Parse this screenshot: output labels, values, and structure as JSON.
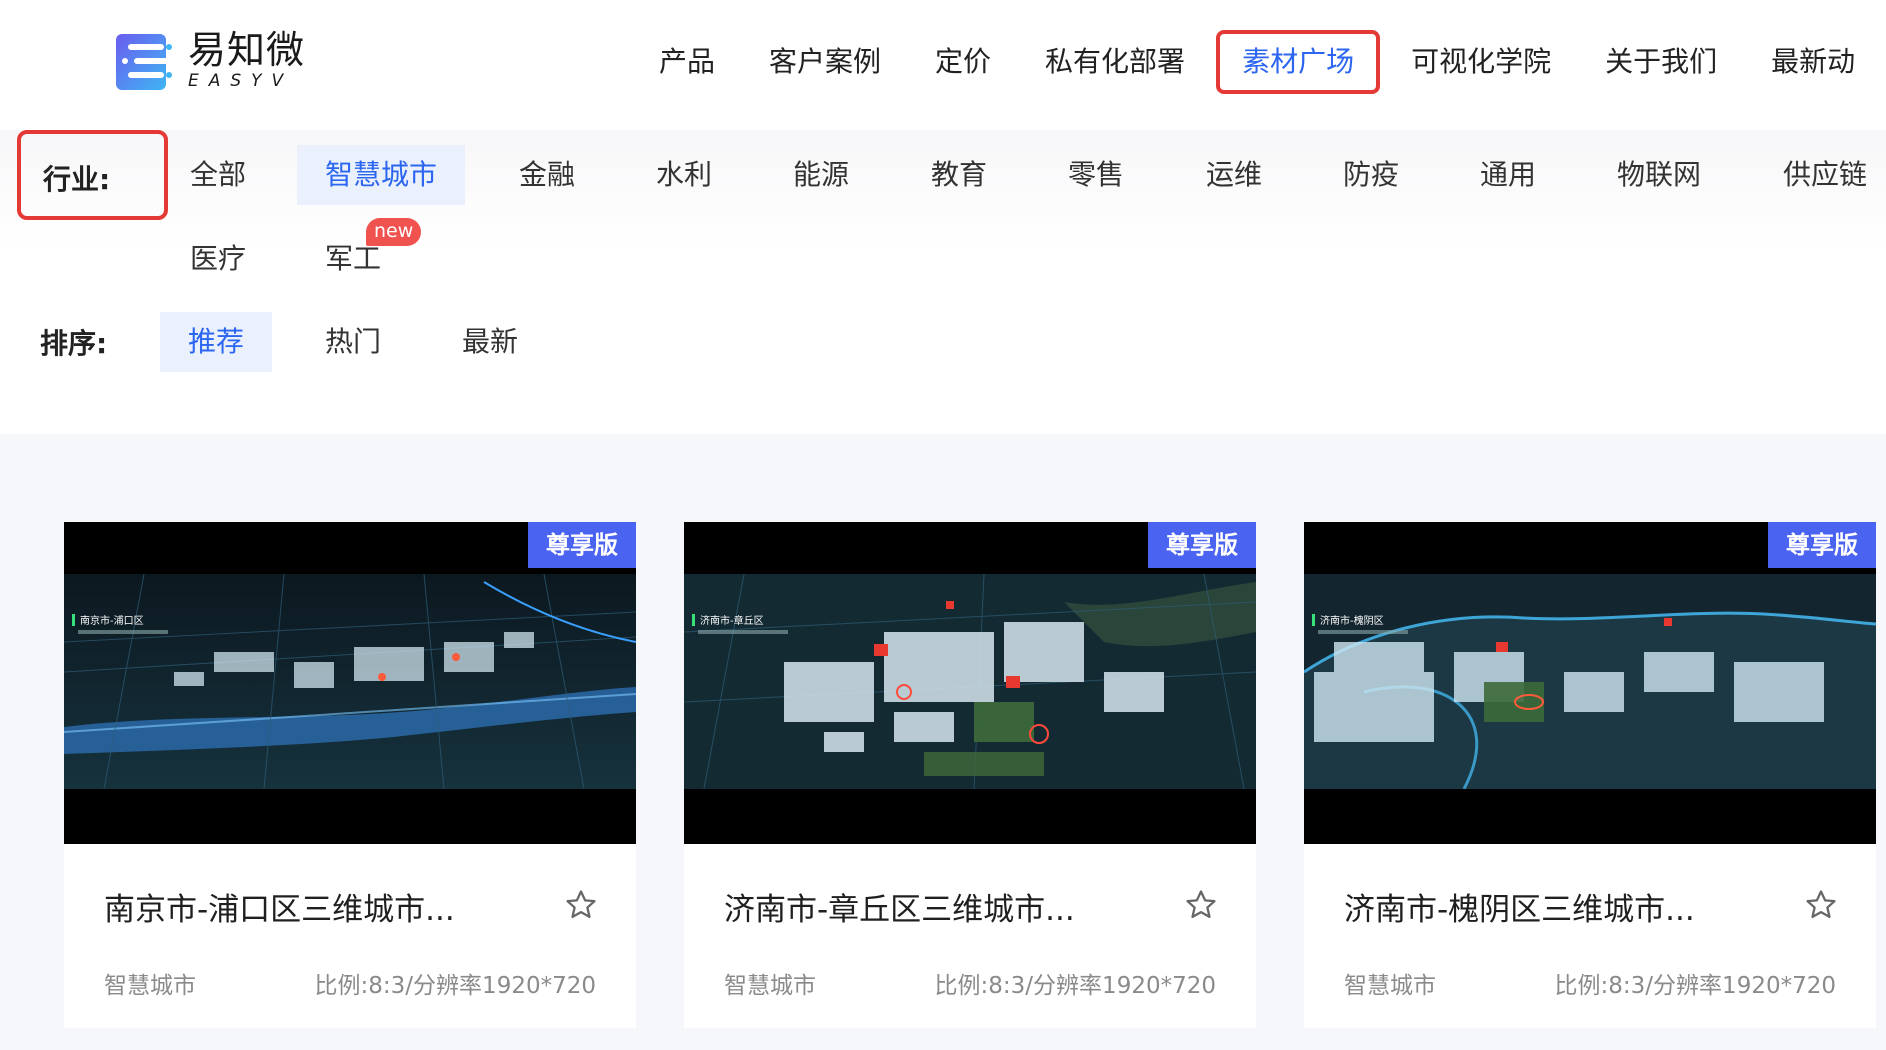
{
  "brand": {
    "name_cn": "易知微",
    "name_en": "EASYV"
  },
  "nav": {
    "items": [
      {
        "label": "产品"
      },
      {
        "label": "客户案例"
      },
      {
        "label": "定价"
      },
      {
        "label": "私有化部署"
      },
      {
        "label": "素材广场",
        "active": true
      },
      {
        "label": "可视化学院"
      },
      {
        "label": "关于我们"
      },
      {
        "label": "最新动"
      }
    ]
  },
  "filters": {
    "industry_label": "行业:",
    "industries": [
      "全部",
      "智慧城市",
      "金融",
      "水利",
      "能源",
      "教育",
      "零售",
      "运维",
      "防疫",
      "通用",
      "物联网",
      "供应链",
      "医疗",
      "军工"
    ],
    "active_industry": "智慧城市",
    "new_badge": "new",
    "sort_label": "排序:",
    "sorts": [
      "推荐",
      "热门",
      "最新"
    ],
    "active_sort": "推荐"
  },
  "cards": [
    {
      "tier": "尊享版",
      "title": "南京市-浦口区三维城市...",
      "category": "智慧城市",
      "meta": "比例:8:3/分辨率1920*720",
      "thumb_caption": "南京市-浦口区"
    },
    {
      "tier": "尊享版",
      "title": "济南市-章丘区三维城市...",
      "category": "智慧城市",
      "meta": "比例:8:3/分辨率1920*720",
      "thumb_caption": "济南市-章丘区"
    },
    {
      "tier": "尊享版",
      "title": "济南市-槐阴区三维城市...",
      "category": "智慧城市",
      "meta": "比例:8:3/分辨率1920*720",
      "thumb_caption": "济南市-槐阴区"
    }
  ],
  "colors": {
    "accent": "#2b65f0",
    "highlight_border": "#e53935",
    "tier_badge": "#4a63f0",
    "new_badge": "#f0524f"
  },
  "icons": {
    "favorite": "star-outline-icon",
    "logo": "easyv-logo-icon"
  }
}
